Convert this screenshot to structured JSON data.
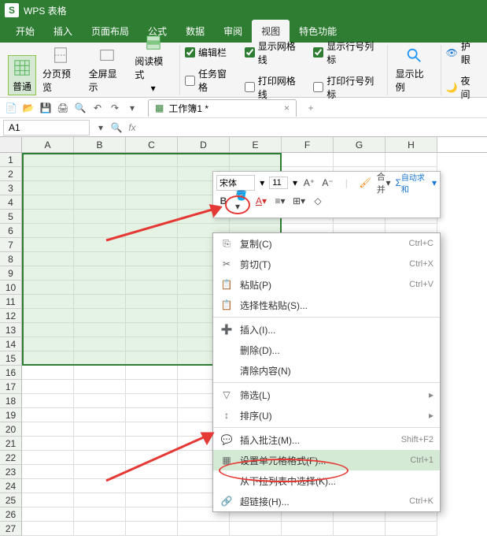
{
  "title": "WPS 表格",
  "menu": {
    "t0": "开始",
    "t1": "插入",
    "t2": "页面布局",
    "t3": "公式",
    "t4": "数据",
    "t5": "审阅",
    "t6": "视图",
    "t7": "特色功能"
  },
  "ribbon": {
    "normal": "普通",
    "pagebreak": "分页预览",
    "fullscreen": "全屏显示",
    "readmode": "阅读模式",
    "editbar": "编辑栏",
    "taskpane": "任务窗格",
    "gridlines": "显示网格线",
    "printgrid": "打印网格线",
    "rowcolhead": "显示行号列标",
    "printhead": "打印行号列标",
    "zoom": "显示比例",
    "eyecare": "护眼",
    "night": "夜间"
  },
  "workbook": "工作簿1 *",
  "cellref": "A1",
  "cols": [
    "A",
    "B",
    "C",
    "D",
    "E",
    "F",
    "G",
    "H"
  ],
  "rows": [
    "1",
    "2",
    "3",
    "4",
    "5",
    "6",
    "7",
    "8",
    "9",
    "10",
    "11",
    "12",
    "13",
    "14",
    "15",
    "16",
    "17",
    "18",
    "19",
    "20",
    "21",
    "22",
    "23",
    "24",
    "25",
    "26",
    "27"
  ],
  "minibar": {
    "font": "宋体",
    "size": "11",
    "merge": "合并",
    "autosum": "自动求和"
  },
  "ctx": {
    "copy": "复制(C)",
    "copy_sc": "Ctrl+C",
    "cut": "剪切(T)",
    "cut_sc": "Ctrl+X",
    "paste": "粘贴(P)",
    "paste_sc": "Ctrl+V",
    "pastespecial": "选择性粘贴(S)...",
    "insert": "插入(I)...",
    "delete": "删除(D)...",
    "clear": "清除内容(N)",
    "filter": "筛选(L)",
    "sort": "排序(U)",
    "comment": "插入批注(M)...",
    "comment_sc": "Shift+F2",
    "format": "设置单元格格式(F)...",
    "format_sc": "Ctrl+1",
    "dropdown": "从下拉列表中选择(K)...",
    "hyperlink": "超链接(H)...",
    "hyperlink_sc": "Ctrl+K"
  }
}
